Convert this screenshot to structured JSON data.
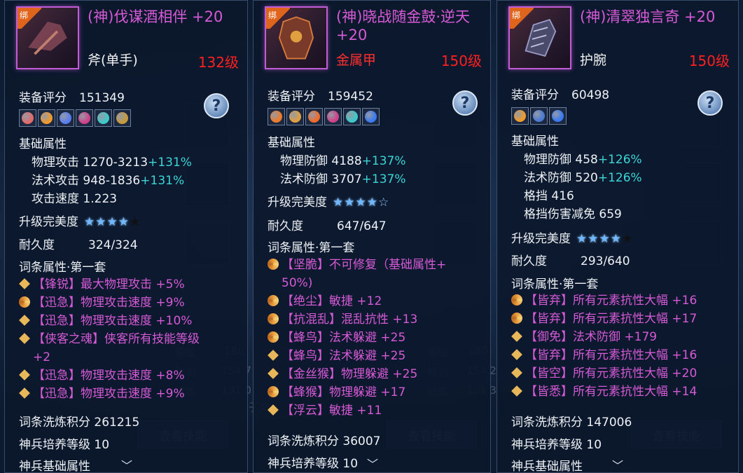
{
  "background": {
    "labels": [
      "等级",
      "160",
      "修为",
      "154.7",
      "修炼",
      "131.0",
      "等级",
      "160",
      "修为",
      "154.2",
      "修炼",
      "131.3"
    ],
    "button_label": "查看技能",
    "side_text": "子湖"
  },
  "panels": [
    {
      "bind_label": "绑",
      "name": "(神)伐谋酒相伴 +20",
      "type": "斧(单手)",
      "type_color": "normal",
      "level": "132级",
      "score_label": "装备评分",
      "score": "151349",
      "gems": [
        "#e26a6a",
        "#f09a2a",
        "#5a7df2",
        "#d0408a",
        "#3ec9c9",
        "#c89a3a"
      ],
      "base_title": "基础属性",
      "base_stats": [
        {
          "label": "物理攻击",
          "value": "1270-3213",
          "bonus": "+131%"
        },
        {
          "label": "法术攻击",
          "value": "948-1836",
          "bonus": "+131%"
        },
        {
          "label": "攻击速度",
          "value": "1.223",
          "bonus": ""
        }
      ],
      "perfect_label": "升级完美度",
      "stars": [
        1,
        1,
        1,
        1,
        0
      ],
      "durability_label": "耐久度",
      "durability": "324/324",
      "affix_title": "词条属性·第一套",
      "affixes": [
        {
          "icon": "diamond",
          "text": "【锋锐】最大物理攻击 +5%"
        },
        {
          "icon": "swirl",
          "text": "【迅急】物理攻击速度 +9%"
        },
        {
          "icon": "diamond",
          "text": "【迅急】物理攻击速度 +10%"
        },
        {
          "icon": "diamond",
          "text": "【侠客之魂】侠客所有技能等级",
          "cont": "+2"
        },
        {
          "icon": "diamond",
          "text": "【迅急】物理攻击速度 +8%"
        },
        {
          "icon": "diamond",
          "text": "【迅急】物理攻击速度 +9%"
        }
      ],
      "refine_label": "词条洗炼积分",
      "refine_value": "261215",
      "cultivate_label": "神兵培养等级",
      "cultivate_value": "10",
      "divine_label": "神兵基础属性"
    },
    {
      "bind_label": "绑",
      "name": "(神)晓战随金鼓·逆天 +20",
      "type": "金属甲",
      "type_color": "red",
      "level": "150级",
      "score_label": "装备评分",
      "score": "159452",
      "gems": [
        "#f07a2a",
        "#e0a040",
        "#f06a2a",
        "#d0408a",
        "#3ec9c9",
        "#3a7af2"
      ],
      "base_title": "基础属性",
      "base_stats": [
        {
          "label": "物理防御",
          "value": "4188",
          "bonus": "+137%"
        },
        {
          "label": "法术防御",
          "value": "3707",
          "bonus": "+137%"
        }
      ],
      "perfect_label": "升级完美度",
      "stars": [
        1,
        1,
        1,
        1,
        2
      ],
      "durability_label": "耐久度",
      "durability": "647/647",
      "affix_title": "词条属性·第一套",
      "affixes": [
        {
          "icon": "swirl",
          "text": "【坚脆】不可修复（基础属性+",
          "cont": "50%)"
        },
        {
          "icon": "swirl",
          "text": "【绝尘】敏捷 +12"
        },
        {
          "icon": "swirl",
          "text": "【抗混乱】混乱抗性 +13"
        },
        {
          "icon": "swirl",
          "text": "【蜂鸟】法术躲避 +25"
        },
        {
          "icon": "diamond",
          "text": "【蜂鸟】法术躲避 +25"
        },
        {
          "icon": "diamond",
          "text": "【金丝猴】物理躲避 +25"
        },
        {
          "icon": "swirl",
          "text": "【蜂猴】物理躲避 +17"
        },
        {
          "icon": "diamond",
          "text": "【浮云】敏捷 +11"
        }
      ],
      "refine_label": "词条洗炼积分",
      "refine_value": "36007",
      "cultivate_label": "神兵培养等级",
      "cultivate_value": "10"
    },
    {
      "bind_label": "绑",
      "name": "(神)清翠独言奇 +20",
      "type": "护腕",
      "type_color": "normal",
      "level": "150级",
      "score_label": "装备评分",
      "score": "60498",
      "gems": [
        "#f09a2a",
        "#4a7ad2",
        "#3a7af2"
      ],
      "base_title": "基础属性",
      "base_stats": [
        {
          "label": "物理防御",
          "value": "458",
          "bonus": "+126%"
        },
        {
          "label": "法术防御",
          "value": "520",
          "bonus": "+126%"
        },
        {
          "label": "格挡",
          "value": "416",
          "bonus": ""
        },
        {
          "label": "格挡伤害减免",
          "value": "659",
          "bonus": ""
        }
      ],
      "perfect_label": "升级完美度",
      "stars": [
        1,
        1,
        1,
        1,
        0
      ],
      "durability_label": "耐久度",
      "durability": "293/640",
      "affix_title": "词条属性·第一套",
      "affixes": [
        {
          "icon": "swirl",
          "text": "【皆弃】所有元素抗性大幅 +16"
        },
        {
          "icon": "swirl",
          "text": "【皆弃】所有元素抗性大幅 +17"
        },
        {
          "icon": "diamond",
          "text": "【御免】法术防御 +179"
        },
        {
          "icon": "diamond",
          "text": "【皆弃】所有元素抗性大幅 +16"
        },
        {
          "icon": "diamond",
          "text": "【皆空】所有元素抗性大幅 +20"
        },
        {
          "icon": "diamond",
          "text": "【皆悉】所有元素抗性大幅 +14"
        }
      ],
      "refine_label": "词条洗炼积分",
      "refine_value": "147006",
      "cultivate_label": "神兵培养等级",
      "cultivate_value": "10",
      "divine_label": "神兵基础属性"
    }
  ]
}
